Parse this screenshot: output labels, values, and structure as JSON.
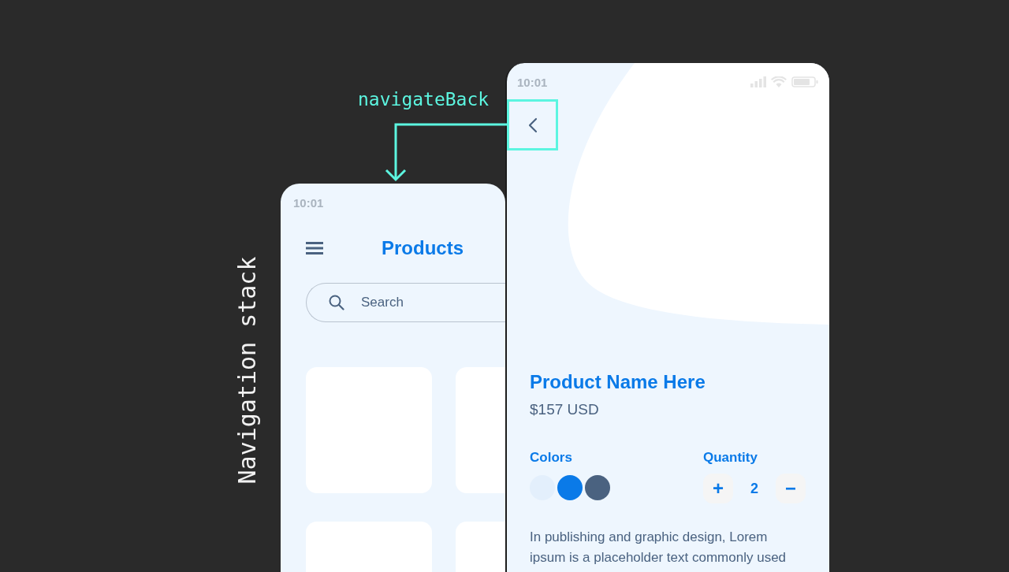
{
  "stack_label": "Navigation stack",
  "transition": {
    "label": "navigateBack"
  },
  "list_screen": {
    "status_time": "10:01",
    "title": "Products",
    "search": {
      "placeholder": "Search"
    }
  },
  "detail_screen": {
    "status_time": "10:01",
    "product": {
      "name": "Product Name Here",
      "price": "$157 USD"
    },
    "colors": {
      "label": "Colors",
      "swatches": [
        {
          "color": "#e3effc"
        },
        {
          "color": "#0a7ae8"
        },
        {
          "color": "#4a6280"
        }
      ]
    },
    "quantity": {
      "label": "Quantity",
      "increment": "+",
      "value": "2",
      "decrement": "−"
    },
    "description": "In publishing and graphic design, Lorem ipsum is a placeholder text commonly used"
  }
}
